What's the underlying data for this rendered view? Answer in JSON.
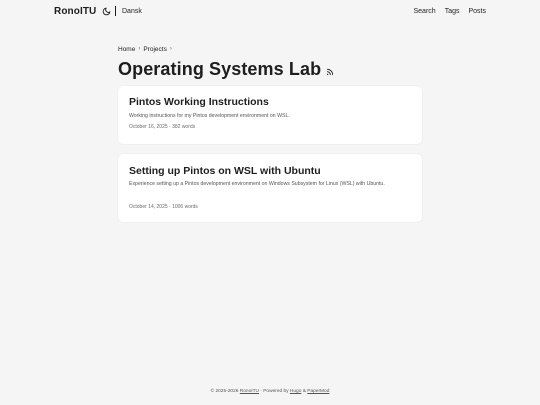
{
  "header": {
    "logo": "RonoITU",
    "language": "Dansk",
    "menu": [
      "Search",
      "Tags",
      "Posts"
    ]
  },
  "breadcrumbs": [
    "Home",
    "Projects"
  ],
  "breadcrumb_separator": "›",
  "page_title": "Operating Systems Lab",
  "posts": [
    {
      "title": "Pintos Working Instructions",
      "summary": "Working instructions for my Pintos development environment on WSL.",
      "meta": "October 16, 2025 · 382 words"
    },
    {
      "title": "Setting up Pintos on WSL with Ubuntu",
      "summary": "Experience setting up a Pintos development environment on Windows Subsystem for Linux (WSL) with Ubuntu.",
      "meta": "October 14, 2025 · 1006 words"
    }
  ],
  "footer": {
    "copyright": "© 2025-2026",
    "owner": "RonoITU",
    "powered_prefix": " · Powered by ",
    "hugo": "Hugo",
    "amp": " & ",
    "theme": "PaperMod"
  },
  "icons": {
    "theme_toggle": "moon-icon",
    "rss": "rss-icon"
  }
}
